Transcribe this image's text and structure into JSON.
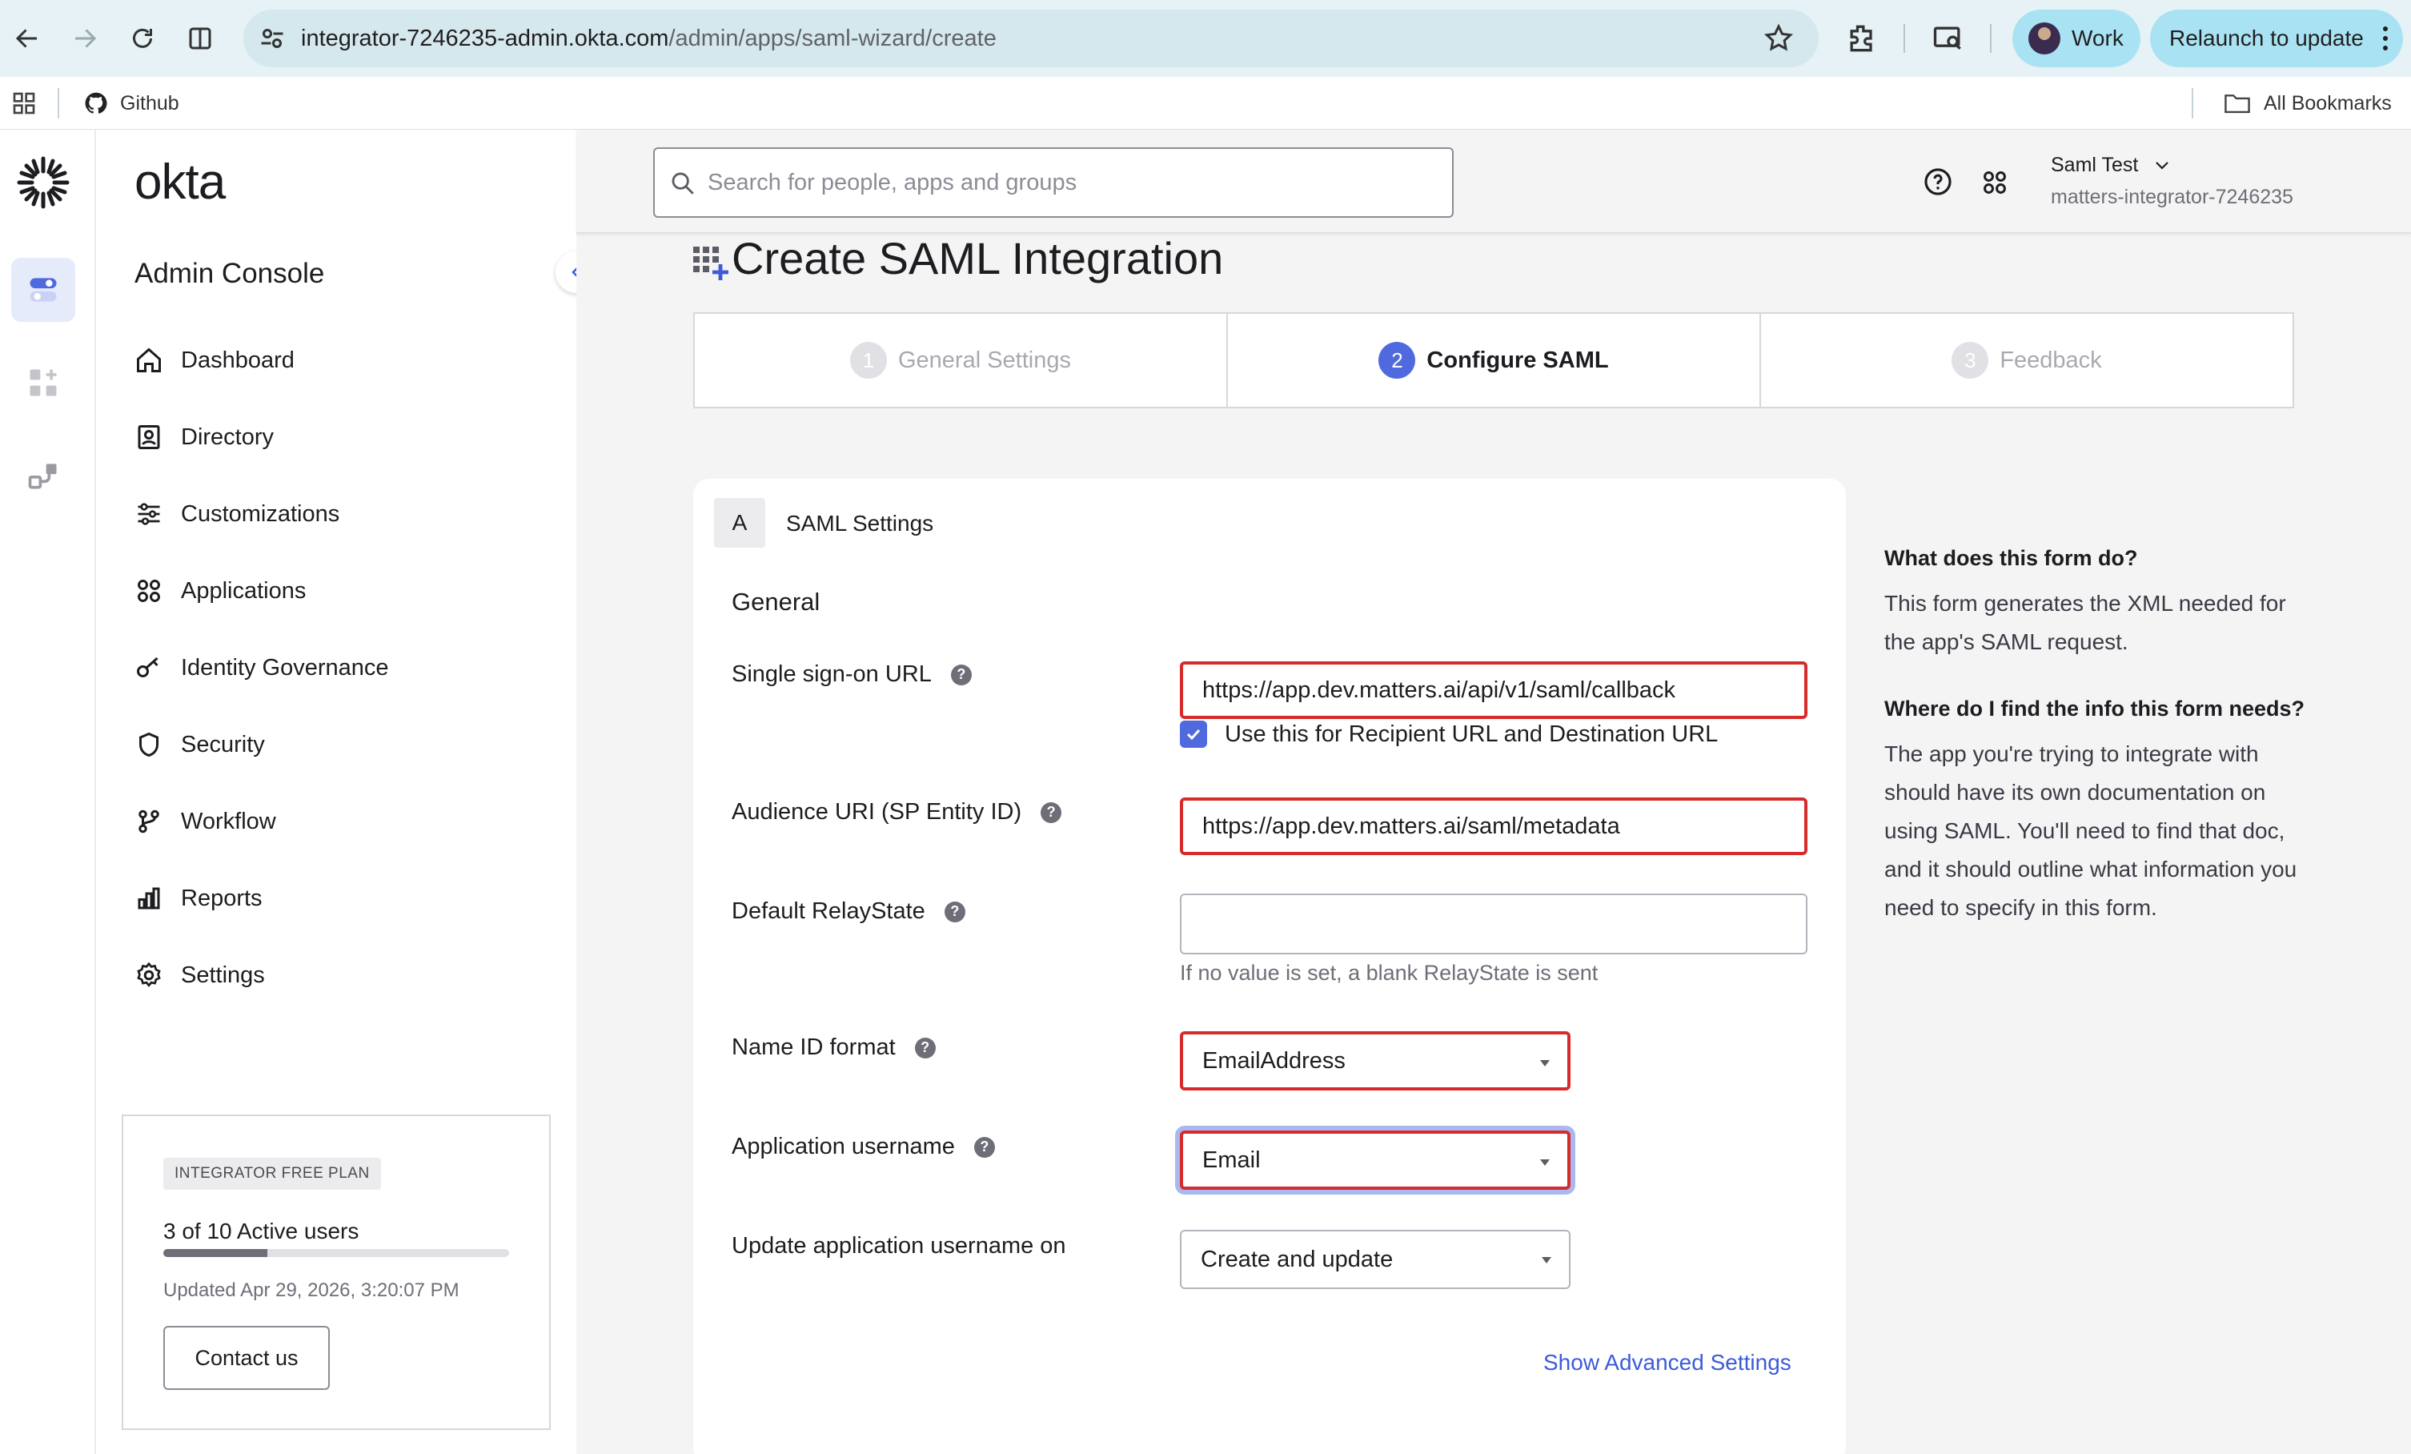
{
  "browser": {
    "url_domain": "integrator-7246235-admin.okta.com",
    "url_path": "/admin/apps/saml-wizard/create",
    "profile_label": "Work",
    "relaunch_label": "Relaunch to update",
    "bookmarks": [
      {
        "label": "Github",
        "icon": "github-icon"
      }
    ],
    "all_bookmarks_label": "All Bookmarks"
  },
  "sidebar": {
    "brand": "okta",
    "console_title": "Admin Console",
    "items": [
      {
        "label": "Dashboard",
        "icon": "home-icon"
      },
      {
        "label": "Directory",
        "icon": "directory-icon"
      },
      {
        "label": "Customizations",
        "icon": "sliders-icon"
      },
      {
        "label": "Applications",
        "icon": "grid-icon"
      },
      {
        "label": "Identity Governance",
        "icon": "key-icon"
      },
      {
        "label": "Security",
        "icon": "shield-icon"
      },
      {
        "label": "Workflow",
        "icon": "workflow-icon"
      },
      {
        "label": "Reports",
        "icon": "bar-chart-icon"
      },
      {
        "label": "Settings",
        "icon": "gear-icon"
      }
    ],
    "plan": {
      "badge": "INTEGRATOR FREE PLAN",
      "users_text": "3 of 10 Active users",
      "users_fraction": 0.3,
      "updated": "Updated Apr 29, 2026, 3:20:07 PM",
      "contact_label": "Contact us"
    }
  },
  "header": {
    "search_placeholder": "Search for people, apps and groups",
    "user_name": "Saml Test",
    "user_org": "matters-integrator-7246235"
  },
  "page": {
    "title": "Create SAML Integration",
    "steps": [
      {
        "num": "1",
        "label": "General Settings",
        "active": false
      },
      {
        "num": "2",
        "label": "Configure SAML",
        "active": true
      },
      {
        "num": "3",
        "label": "Feedback",
        "active": false
      }
    ]
  },
  "form": {
    "section_letter": "A",
    "section_title": "SAML Settings",
    "general_heading": "General",
    "sso_url_label": "Single sign-on URL",
    "sso_url_value": "https://app.dev.matters.ai/api/v1/saml/callback",
    "recipient_checkbox_label": "Use this for Recipient URL and Destination URL",
    "audience_label": "Audience URI (SP Entity ID)",
    "audience_value": "https://app.dev.matters.ai/saml/metadata",
    "relaystate_label": "Default RelayState",
    "relaystate_value": "",
    "relaystate_hint": "If no value is set, a blank RelayState is sent",
    "nameid_label": "Name ID format",
    "nameid_value": "EmailAddress",
    "app_username_label": "Application username",
    "app_username_value": "Email",
    "update_on_label": "Update application username on",
    "update_on_value": "Create and update",
    "advanced_link": "Show Advanced Settings"
  },
  "help": {
    "q1": "What does this form do?",
    "a1": "This form generates the XML needed for the app's SAML request.",
    "q2": "Where do I find the info this form needs?",
    "a2": "The app you're trying to integrate with should have its own documentation on using SAML. You'll need to find that doc, and it should outline what information you need to specify in this form."
  },
  "colors": {
    "accent": "#4f6ade",
    "highlight": "#d62b2b",
    "chrome": "#e6f2f5"
  }
}
